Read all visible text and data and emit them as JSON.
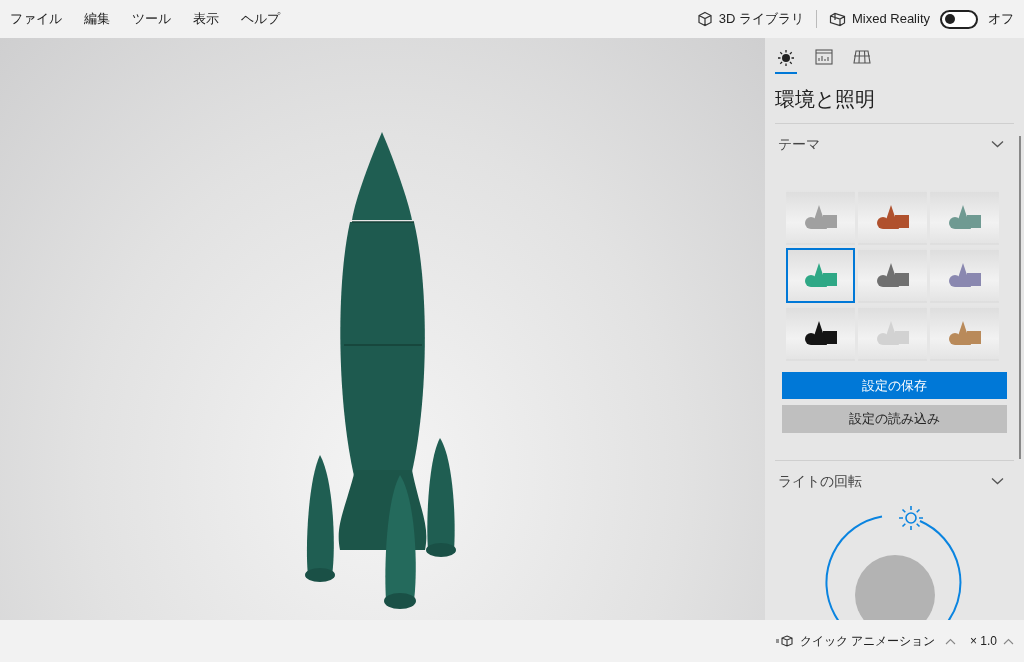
{
  "menu": [
    "ファイル",
    "編集",
    "ツール",
    "表示",
    "ヘルプ"
  ],
  "toolbar": {
    "library": "3D ライブラリ",
    "mixed_reality": {
      "label": "Mixed Reality",
      "on": false,
      "state_text": "オフ"
    }
  },
  "panel": {
    "tabs": [
      {
        "kind": "lighting",
        "selected": true
      },
      {
        "kind": "stats",
        "selected": false
      },
      {
        "kind": "grid",
        "selected": false
      }
    ],
    "title": "環境と照明",
    "theme_section": {
      "heading": "テーマ",
      "expanded": true,
      "themes": [
        {
          "color": "#a0a0a0",
          "selected": false
        },
        {
          "color": "#b0512d",
          "selected": false
        },
        {
          "color": "#6f9a92",
          "selected": false
        },
        {
          "color": "#2fa886",
          "selected": true
        },
        {
          "color": "#707070",
          "selected": false
        },
        {
          "color": "#8a88b0",
          "selected": false
        },
        {
          "color": "#151515",
          "selected": false
        },
        {
          "color": "#d2d2d2",
          "selected": false
        },
        {
          "color": "#b98a5a",
          "selected": false
        }
      ],
      "save_button": "設定の保存",
      "load_button": "設定の読み込み"
    },
    "light_section": {
      "heading": "ライトの回転",
      "expanded": true
    }
  },
  "status_bar": {
    "animation": "クイック アニメーション",
    "speed": "× 1.0"
  }
}
